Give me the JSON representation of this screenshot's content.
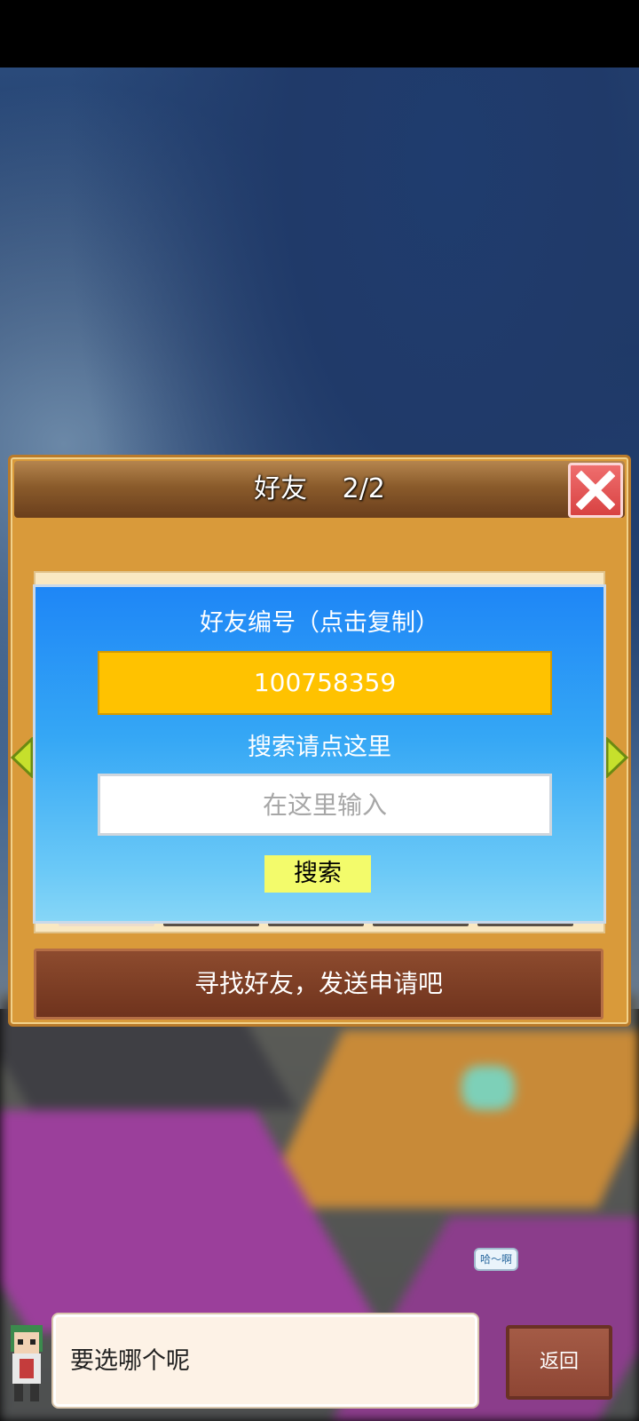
{
  "panel": {
    "title": "好友　 2/2"
  },
  "dialog": {
    "id_label": "好友编号（点击复制）",
    "friend_id": "100758359",
    "search_label": "搜索请点这里",
    "search_placeholder": "在这里输入",
    "search_button": "搜索"
  },
  "find_bar": {
    "label": "寻找好友，发送申请吧"
  },
  "scene": {
    "npc_bubble": "哈～啊"
  },
  "footer": {
    "message": "要选哪个呢",
    "back_label": "返回"
  },
  "icons": {
    "close": "close-icon",
    "left_arrow": "chevron-left-icon",
    "right_arrow": "chevron-right-icon"
  },
  "colors": {
    "id_box": "#ffc200",
    "search_button": "#f3fb6b",
    "close_button": "#d84242"
  }
}
